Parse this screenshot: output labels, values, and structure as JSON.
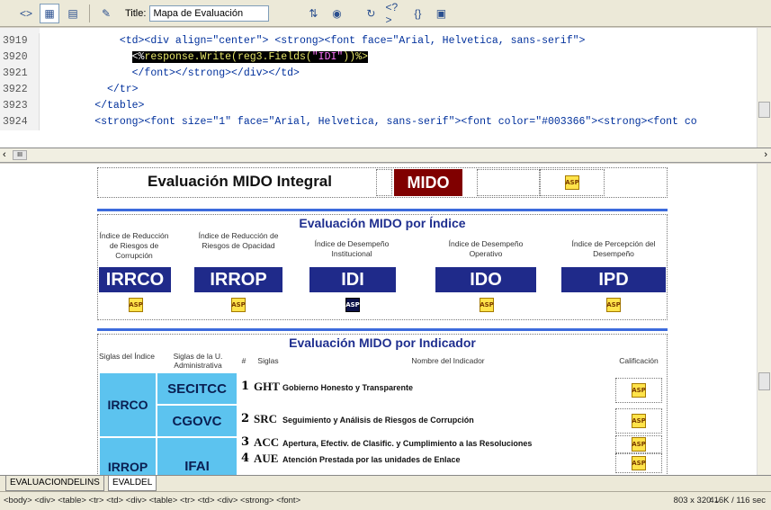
{
  "toolbar": {
    "title_label": "Title:",
    "title_value": "Mapa de Evaluación",
    "icons": [
      "code-view-icon",
      "split-view-icon",
      "design-view-icon",
      "live-data-icon",
      "file-management-icon",
      "preview-browser-icon",
      "refresh-icon",
      "code-nav-icon",
      "braces-icon",
      "visual-aids-icon"
    ]
  },
  "code": {
    "lines": [
      {
        "num": "3919",
        "text": "            <td><div align=\"center\"> <strong><font face=\"Arial, Helvetica, sans-serif\">"
      },
      {
        "num": "3920",
        "pre": "              ",
        "hl_open": "<%",
        "hl_code": "response.Write(reg3.Fields(",
        "hl_str": "\"IDI\"",
        "hl_close": "))%>"
      },
      {
        "num": "3921",
        "text": "              </font></strong></div></td>"
      },
      {
        "num": "3922",
        "text": "          </tr>"
      },
      {
        "num": "3923",
        "text": "        </table>"
      },
      {
        "num": "3924",
        "text": "        <strong><font size=\"1\" face=\"Arial, Helvetica, sans-serif\"><font color=\"#003366\"><strong><font co"
      }
    ],
    "scroll_left_arrow": "‹ ",
    "scroll_mid": "III"
  },
  "design": {
    "integral_title": "Evaluación MIDO Integral",
    "mido_label": "MIDO",
    "asp_text": "ASP",
    "indice_title": "Evaluación MIDO por Índice",
    "indices": [
      {
        "label": "Índice de Reducción de Riesgos de Corrupción",
        "code": "IRRCO"
      },
      {
        "label": "Índice de Reducción de Riesgos de Opacidad",
        "code": "IRROP"
      },
      {
        "label": "Índice de Desempeño Institucional",
        "code": "IDI"
      },
      {
        "label": "Índice de Desempeño Operativo",
        "code": "IDO"
      },
      {
        "label": "Índice de Percepción del Desempeño",
        "code": "IPD"
      }
    ],
    "indicador_title": "Evaluación MIDO por Indicador",
    "headers": {
      "siglas_indice": "Siglas del Índice",
      "siglas_u": "Siglas de la U. Administrativa",
      "num": "#",
      "siglas": "Siglas",
      "nombre": "Nombre del Indicador",
      "calificacion": "Calificación"
    },
    "groups": [
      "IRRCO",
      "IRROP"
    ],
    "units": [
      "SECITCC",
      "CGOVC",
      "IFAI"
    ],
    "rows": [
      {
        "num": "1",
        "sigla": "GHT",
        "name": "Gobierno Honesto y Transparente"
      },
      {
        "num": "2",
        "sigla": "SRC",
        "name": "Seguimiento y Análisis de Riesgos de Corrupción"
      },
      {
        "num": "3",
        "sigla": "ACC",
        "name": "Apertura, Efectiv. de Clasific. y Cumplimiento a las Resoluciones"
      },
      {
        "num": "4",
        "sigla": "AUE",
        "name": "Atención Prestada por las unidades de Enlace"
      }
    ]
  },
  "tabs": [
    {
      "label": "EVALUACIONDELINS",
      "active": false
    },
    {
      "label": "EVALDEL",
      "active": true
    }
  ],
  "status": {
    "tag_path": "<body> <div> <table> <tr> <td> <div> <table> <tr> <td> <div> <strong> <font>",
    "dimensions": "803 x 320 ⌄",
    "size_time": "416K / 116 sec"
  }
}
